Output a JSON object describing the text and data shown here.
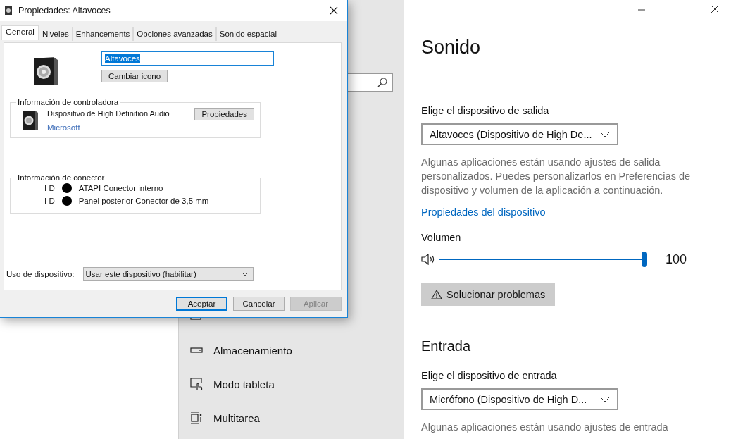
{
  "settings": {
    "nav_items": [
      {
        "label": "Almacenamiento"
      },
      {
        "label": "Modo tableta"
      },
      {
        "label": "Multitarea"
      }
    ],
    "title": "Sonido",
    "output": {
      "label": "Elige el dispositivo de salida",
      "value": "Altavoces (Dispositivo de High De...",
      "note": "Algunas aplicaciones están usando ajustes de salida personalizados. Puedes personalizarlos en Preferencias de dispositivo y volumen de la aplicación a continuación.",
      "link": "Propiedades del dispositivo"
    },
    "volume": {
      "label": "Volumen",
      "level": 1.0,
      "reading": "100"
    },
    "troubleshoot_button": "Solucionar problemas",
    "input_heading": "Entrada",
    "input": {
      "label": "Elige el dispositivo de entrada",
      "value": "Micrófono (Dispositivo de High D...",
      "note": "Algunas aplicaciones están usando ajustes de entrada"
    }
  },
  "dialog": {
    "title": "Propiedades: Altavoces",
    "tabs": [
      {
        "label": "General",
        "selected": true
      },
      {
        "label": "Niveles",
        "selected": false
      },
      {
        "label": "Enhancements",
        "selected": false
      },
      {
        "label": "Opciones avanzadas",
        "selected": false
      },
      {
        "label": "Sonido espacial",
        "selected": false
      }
    ],
    "name_field": {
      "value": "Altavoces"
    },
    "change_icon_button": "Cambiar icono",
    "controller_group": {
      "title": "Información de controladora",
      "device": "Dispositivo de High Definition Audio",
      "properties_button": "Propiedades",
      "vendor": "Microsoft"
    },
    "connector_group": {
      "title": "Información de conector",
      "connectors": [
        {
          "id_label": "I D",
          "color": "#000000",
          "name": "ATAPI Conector interno"
        },
        {
          "id_label": "I D",
          "color": "#000000",
          "name": "Panel posterior Conector de 3,5 mm"
        }
      ]
    },
    "device_usage": {
      "label": "Uso de dispositivo:",
      "value": "Usar este dispositivo (habilitar)"
    },
    "buttons": [
      {
        "label": "Aceptar",
        "kind": "default",
        "disabled": false
      },
      {
        "label": "Cancelar",
        "kind": "normal",
        "disabled": false
      },
      {
        "label": "Aplicar",
        "kind": "normal",
        "disabled": true
      }
    ]
  }
}
